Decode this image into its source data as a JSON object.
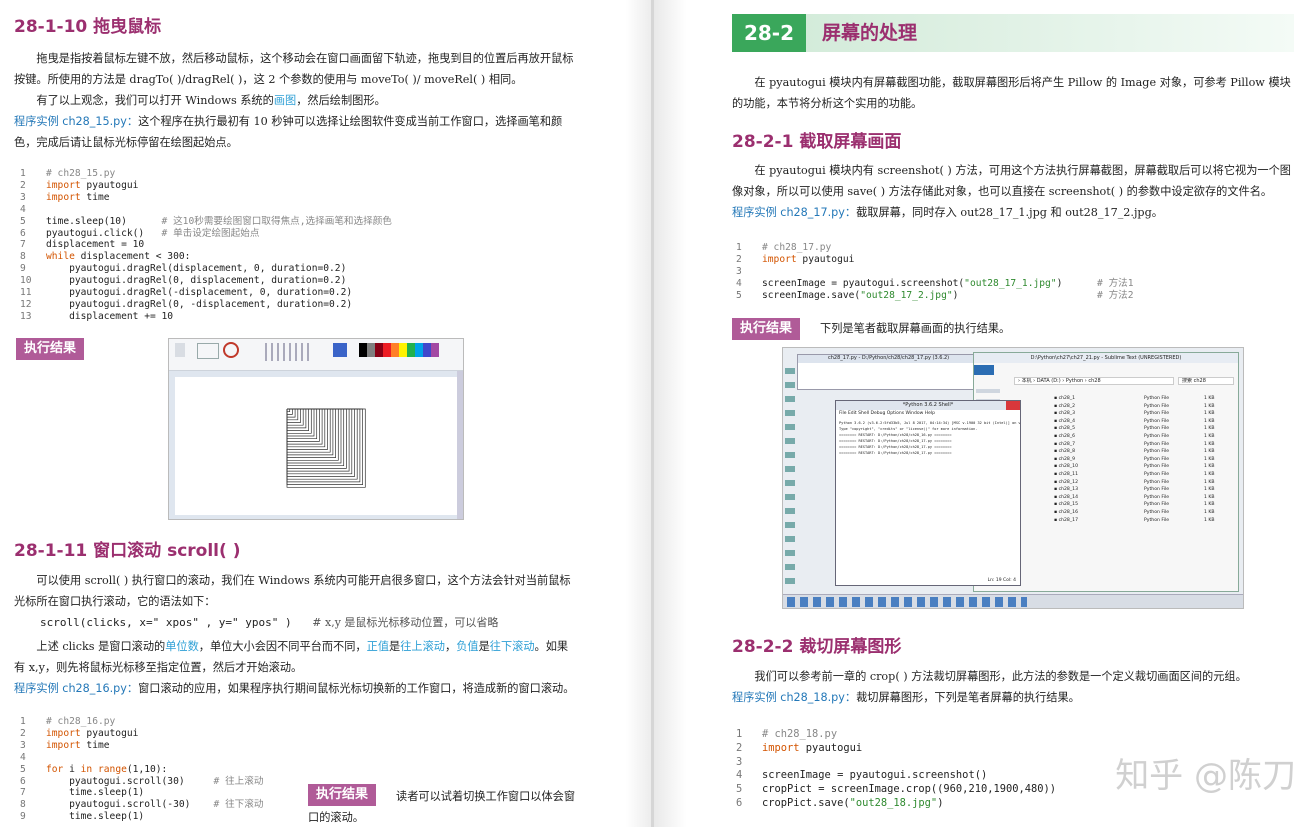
{
  "left": {
    "h_drag": "28-1-10   拖曳鼠标",
    "drag_p1": "拖曳是指按着鼠标左键不放，然后移动鼠标，这个移动会在窗口画面留下轨迹，拖曳到目的位置后再放开鼠标按键。所使用的方法是 dragTo( )/dragRel( )，这 2 个参数的使用与 moveTo( )/ moveRel( ) 相同。",
    "drag_p2_a": "有了以上观念，我们可以打开 Windows 系统的",
    "drag_p2_link": "画图",
    "drag_p2_b": "，然后绘制图形。",
    "ex15_label": "程序实例 ch28_15.py：",
    "ex15_desc": "这个程序在执行最初有 10 秒钟可以选择让绘图软件变成当前工作窗口，选择画笔和颜色，完成后请让鼠标光标停留在绘图起始点。",
    "code15": [
      {
        "n": "1",
        "t": "# ch28_15.py"
      },
      {
        "n": "2",
        "t": "import pyautogui"
      },
      {
        "n": "3",
        "t": "import time"
      },
      {
        "n": "4",
        "t": ""
      },
      {
        "n": "5",
        "t": "time.sleep(10)      # 这10秒需要绘图窗口取得焦点,选择画笔和选择颜色"
      },
      {
        "n": "6",
        "t": "pyautogui.click()   # 单击设定绘图起始点"
      },
      {
        "n": "7",
        "t": "displacement = 10"
      },
      {
        "n": "8",
        "t": "while displacement < 300:"
      },
      {
        "n": "9",
        "t": "    pyautogui.dragRel(displacement, 0, duration=0.2)"
      },
      {
        "n": "10",
        "t": "    pyautogui.dragRel(0, displacement, duration=0.2)"
      },
      {
        "n": "11",
        "t": "    pyautogui.dragRel(-displacement, 0, duration=0.2)"
      },
      {
        "n": "12",
        "t": "    pyautogui.dragRel(0, -displacement, duration=0.2)"
      },
      {
        "n": "13",
        "t": "    displacement += 10"
      }
    ],
    "result_badge": "执行结果",
    "h_scroll": "28-1-11   窗口滚动 scroll( )",
    "scroll_p1": "可以使用 scroll( ) 执行窗口的滚动，我们在 Windows 系统内可能开启很多窗口，这个方法会针对当前鼠标光标所在窗口执行滚动，它的语法如下：",
    "scroll_syntax": "scroll(clicks, x=\" xpos\" , y=\" ypos\" )",
    "scroll_syntax_comment": "# x,y 是鼠标光标移动位置，可以省略",
    "scroll_p2_a": "上述 clicks 是窗口滚动的",
    "scroll_p2_unit": "单位数",
    "scroll_p2_b": "，单位大小会因不同平台而不同，",
    "scroll_p2_pos": "正值",
    "scroll_p2_c": "是",
    "scroll_p2_up": "往上滚动",
    "scroll_p2_d": "，",
    "scroll_p2_neg": "负值",
    "scroll_p2_e": "是",
    "scroll_p2_down": "往下滚动",
    "scroll_p2_f": "。如果有 x,y，则先将鼠标光标移至指定位置，然后才开始滚动。",
    "ex16_label": "程序实例 ch28_16.py：",
    "ex16_desc": "窗口滚动的应用，如果程序执行期间鼠标光标切换新的工作窗口，将造成新的窗口滚动。",
    "code16": [
      {
        "n": "1",
        "t": "# ch28_16.py"
      },
      {
        "n": "2",
        "t": "import pyautogui"
      },
      {
        "n": "3",
        "t": "import time"
      },
      {
        "n": "4",
        "t": ""
      },
      {
        "n": "5",
        "t": "for i in range(1,10):"
      },
      {
        "n": "6",
        "t": "    pyautogui.scroll(30)     # 往上滚动"
      },
      {
        "n": "7",
        "t": "    time.sleep(1)"
      },
      {
        "n": "8",
        "t": "    pyautogui.scroll(-30)    # 往下滚动"
      },
      {
        "n": "9",
        "t": "    time.sleep(1)"
      }
    ],
    "result_badge2": "执行结果",
    "result16_text": "读者可以试着切换工作窗口以体会窗口的滚动。"
  },
  "right": {
    "sec_num": "28-2",
    "sec_title": "屏幕的处理",
    "intro": "在 pyautogui 模块内有屏幕截图功能，截取屏幕图形后将产生 Pillow 的 Image 对象，可参考 Pillow 模块的功能，本节将分析这个实用的功能。",
    "h_capture": "28-2-1   截取屏幕画面",
    "capture_p": "在 pyautogui 模块内有 screenshot( ) 方法，可用这个方法执行屏幕截图，屏幕截取后可以将它视为一个图像对象，所以可以使用 save( ) 方法存储此对象，也可以直接在 screenshot( ) 的参数中设定欲存的文件名。",
    "ex17_label": "程序实例 ch28_17.py：",
    "ex17_desc": "截取屏幕，同时存入 out28_17_1.jpg 和 out28_17_2.jpg。",
    "code17": [
      {
        "n": "1",
        "t": "# ch28_17.py"
      },
      {
        "n": "2",
        "t": "import pyautogui"
      },
      {
        "n": "3",
        "t": ""
      },
      {
        "n": "4",
        "t": "screenImage = pyautogui.screenshot(\"out28_17_1.jpg\")      # 方法1"
      },
      {
        "n": "5",
        "t": "screenImage.save(\"out28_17_2.jpg\")                        # 方法2"
      }
    ],
    "result_badge": "执行结果",
    "result17_text": "下列是笔者截取屏幕画面的执行结果。",
    "h_crop": "28-2-2   裁切屏幕图形",
    "crop_p": "我们可以参考前一章的 crop( ) 方法裁切屏幕图形，此方法的参数是一个定义裁切画面区间的元组。",
    "ex18_label": "程序实例 ch28_18.py：",
    "ex18_desc": "裁切屏幕图形，下列是笔者屏幕的执行结果。",
    "code18": [
      {
        "n": "1",
        "t": "# ch28_18.py"
      },
      {
        "n": "2",
        "t": "import pyautogui"
      },
      {
        "n": "3",
        "t": ""
      },
      {
        "n": "4",
        "t": "screenImage = pyautogui.screenshot()"
      },
      {
        "n": "5",
        "t": "cropPict = screenImage.crop((960,210,1900,480))"
      },
      {
        "n": "6",
        "t": "cropPict.save(\"out28_18.jpg\")"
      }
    ],
    "watermark": "知乎 @陈刀"
  },
  "screens": {
    "shell_title": "*Python 3.6.2 Shell*",
    "shell_menu": "File  Edit  Shell  Debug  Options  Window  Help",
    "shell_lines": [
      "Python 3.6.2 (v3.6.2:5fd33b5, Jul  8 2017, 04:14:34) [MSC v.1900 32 bit (Intel)] on win32",
      "Type \"copyright\", \"credits\" or \"license()\" for more information.",
      "======== RESTART: D:/Python/ch28/ch28_16.py ========",
      "======== RESTART: D:/Python/ch28/ch28_17.py ========",
      "======== RESTART: D:/Python/ch28/ch28_17.py ========",
      "======== RESTART: D:/Python/ch28/ch28_17.py ========"
    ],
    "shell_status": "Ln: 19  Col: 4",
    "editor_title": "ch28_17.py - D:/Python/ch28/ch28_17.py (3.6.2)",
    "sublime_title": "D:\\Python\\ch27\\ch27_21.py - Sublime Text (UNREGISTERED)",
    "explorer_path": "› 本机 › DATA (D:) › Python › ch28",
    "explorer_search": "搜索 ch28",
    "explorer_files": [
      "ch28_1",
      "ch28_2",
      "ch28_3",
      "ch28_4",
      "ch28_5",
      "ch28_6",
      "ch28_7",
      "ch28_8",
      "ch28_9",
      "ch28_10",
      "ch28_11",
      "ch28_12",
      "ch28_13",
      "ch28_14",
      "ch28_15",
      "ch28_16",
      "ch28_17"
    ],
    "file_type": "Python File",
    "file_size": "1 KB"
  }
}
